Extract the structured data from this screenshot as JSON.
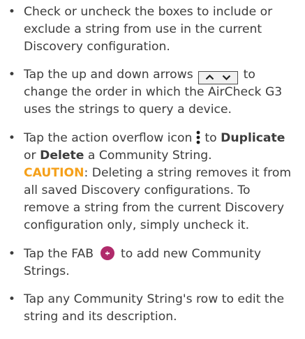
{
  "items": [
    {
      "lines": [
        "Check or uncheck the boxes to include or",
        "exclude a string from use in the current",
        "Discovery configuration."
      ]
    },
    {
      "line1_before": "Tap the up and down arrows",
      "line1_after": "to",
      "lines": [
        "change the order in which the AirCheck G3",
        "uses the strings to query a device."
      ],
      "icons": [
        "chevron-up-icon",
        "chevron-down-icon"
      ]
    },
    {
      "line1_before": "Tap the action overflow icon",
      "line1_to": "to",
      "duplicate": "Duplicate",
      "line2_or": "or",
      "delete": "Delete",
      "line2_after": "a Community String.",
      "caution_label": "CAUTION",
      "caution_text": ": Deleting a string removes it from",
      "caution_lines": [
        "all saved Discovery configurations. To",
        "remove a string from the current Discovery",
        "configuration only, simply uncheck it."
      ],
      "icon": "more-vert-icon"
    },
    {
      "line1_before": "Tap the FAB",
      "line1_after": "to add new Community",
      "lines": [
        "Strings."
      ],
      "icon": "fab-add-icon",
      "fab_color": "#b02a6b"
    },
    {
      "lines": [
        "Tap any Community String's row to edit the",
        "string and its description."
      ]
    }
  ],
  "bullet_char": "•",
  "colors": {
    "text": "#3d3d3d",
    "caution": "#f5a01a"
  }
}
